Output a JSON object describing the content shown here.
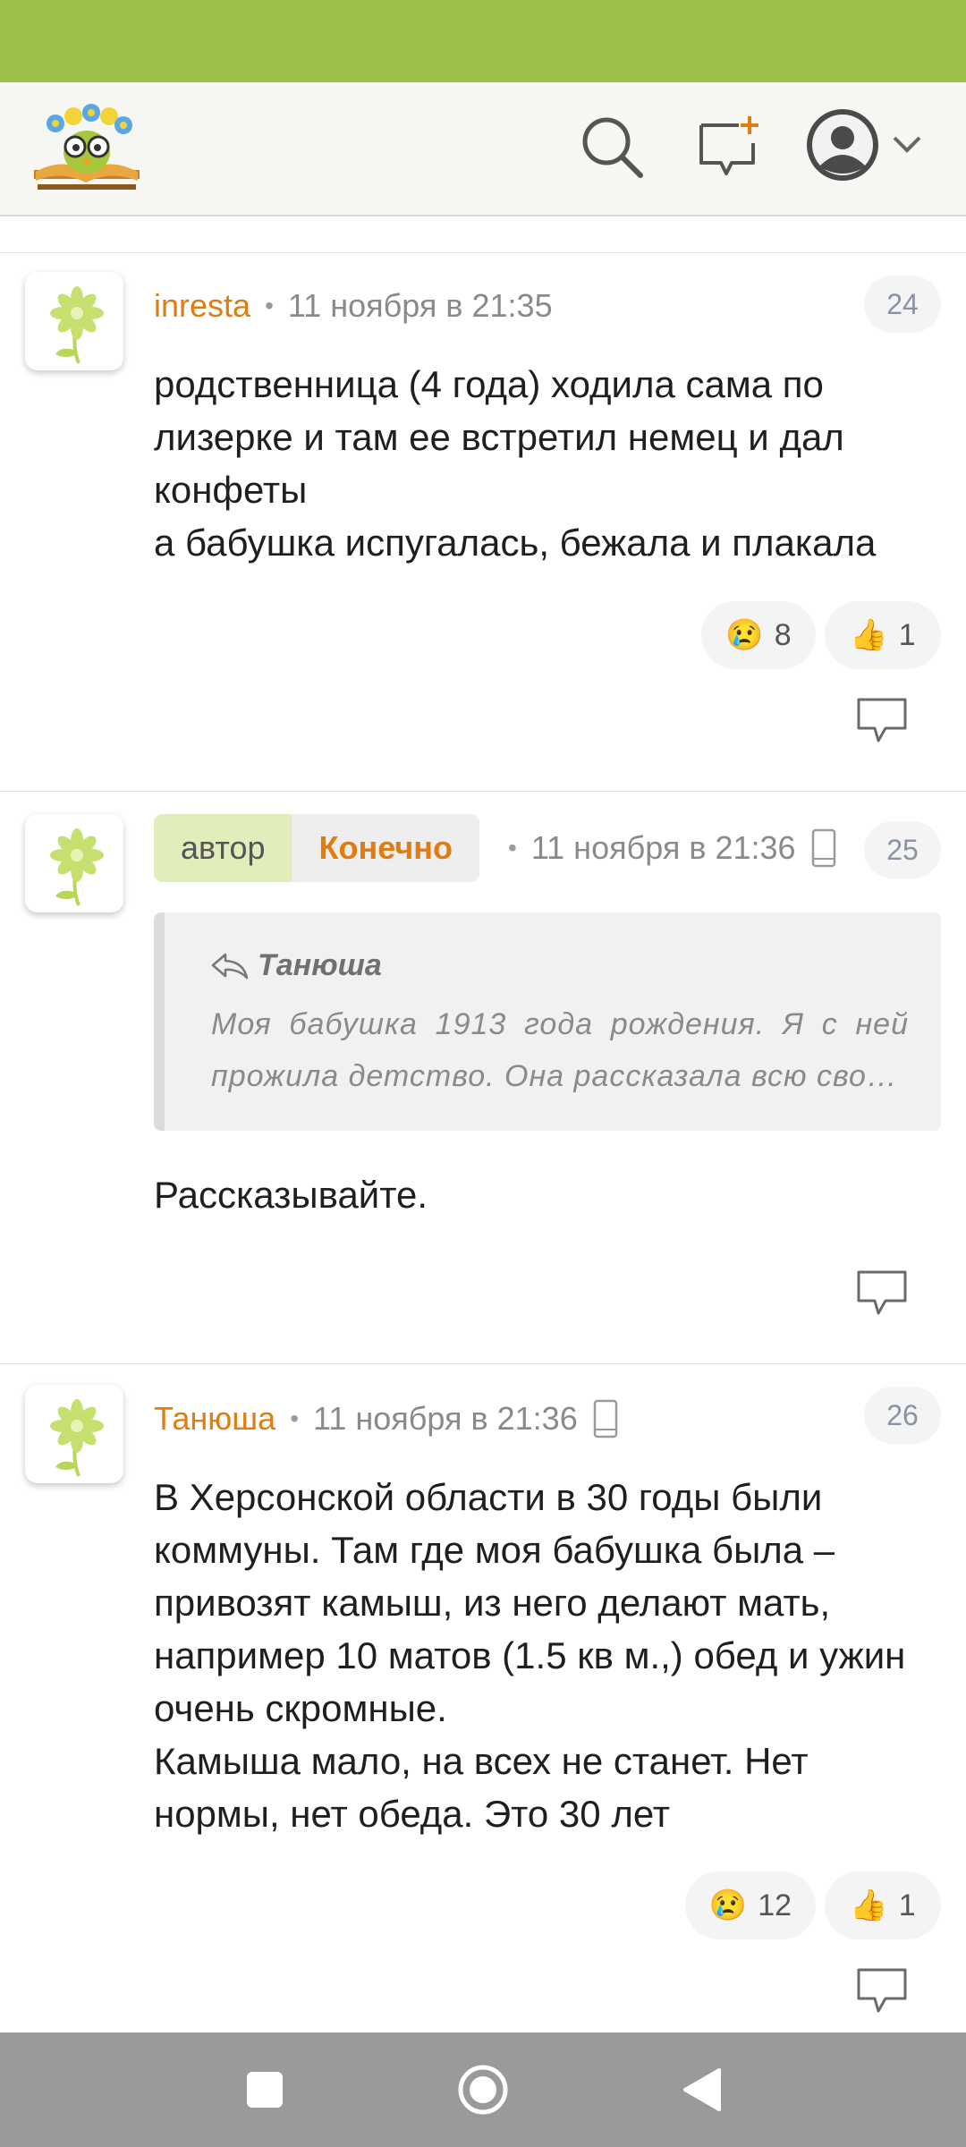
{
  "colors": {
    "statusbar": "#9dc148",
    "accent": "#e07c10",
    "navbar": "#9a9a9a"
  },
  "header": {
    "logo": "book-owl-flowers-logo",
    "search_icon": "search-icon",
    "new_post_icon": "chat-plus-icon",
    "avatar_icon": "user-avatar-icon",
    "dropdown_icon": "chevron-down-icon"
  },
  "comments": [
    {
      "author": "inresta",
      "time": "11 ноября в 21:35",
      "number": "24",
      "text": "родственница (4 года) ходила сама по лизерке и там ее встретил немец и дал конфеты\nа бабушка испугалась, бежала и плакала",
      "reactions": [
        {
          "emoji": "😢",
          "count": "8"
        },
        {
          "emoji": "👍",
          "count": "1"
        }
      ]
    },
    {
      "tag": "автор",
      "author": "Конечно",
      "time": "11 ноября в 21:36",
      "number": "25",
      "device_icon": "mobile-phone-icon",
      "quote": {
        "author": "Танюша",
        "text": "Моя бабушка 1913 года рождения. Я с ней прожила детство. Она рассказала всю сво…"
      },
      "text": "Рассказывайте."
    },
    {
      "author": "Танюша",
      "time": "11 ноября в 21:36",
      "number": "26",
      "device_icon": "mobile-phone-icon",
      "text": "В Херсонской области в 30 годы были коммуны. Там где моя бабушка была – привозят камыш, из него делают мать, например 10 матов (1.5 кв м.,) обед и ужин очень скромные.\nКамыша мало, на всех не станет. Нет нормы, нет обеда. Это 30 лет",
      "reactions": [
        {
          "emoji": "😢",
          "count": "12"
        },
        {
          "emoji": "👍",
          "count": "1"
        }
      ]
    }
  ],
  "navbar": {
    "recents_icon": "square-icon",
    "home_icon": "circle-icon",
    "back_icon": "triangle-back-icon"
  }
}
